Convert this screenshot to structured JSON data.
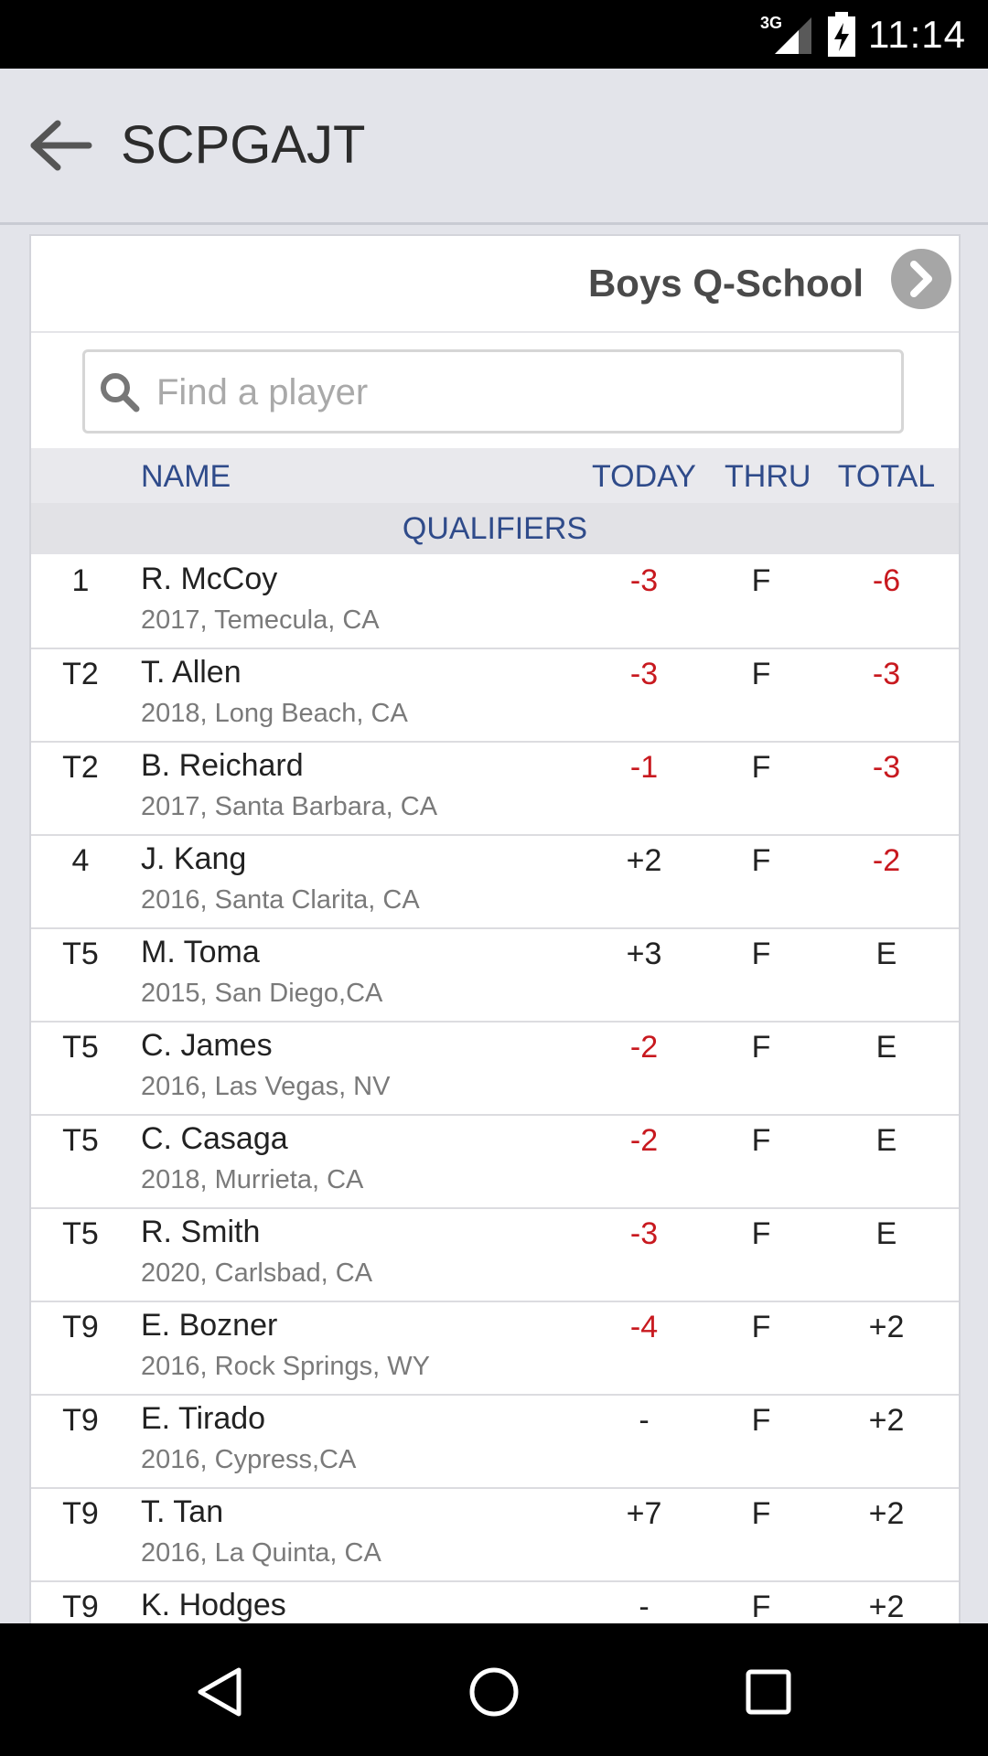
{
  "status_bar": {
    "network": "3G",
    "time": "11:14"
  },
  "app_bar": {
    "title": "SCPGAJT"
  },
  "event": {
    "name": "Boys Q-School"
  },
  "search": {
    "placeholder": "Find a player",
    "value": ""
  },
  "columns": {
    "name": "NAME",
    "today": "TODAY",
    "thru": "THRU",
    "total": "TOTAL"
  },
  "section_label": "QUALIFIERS",
  "players": [
    {
      "pos": "1",
      "name": "R. McCoy",
      "info": "2017, Temecula, CA",
      "today": "-3",
      "thru": "F",
      "total": "-6"
    },
    {
      "pos": "T2",
      "name": "T. Allen",
      "info": "2018, Long Beach, CA",
      "today": "-3",
      "thru": "F",
      "total": "-3"
    },
    {
      "pos": "T2",
      "name": "B. Reichard",
      "info": "2017, Santa Barbara, CA",
      "today": "-1",
      "thru": "F",
      "total": "-3"
    },
    {
      "pos": "4",
      "name": "J. Kang",
      "info": "2016, Santa Clarita, CA",
      "today": "+2",
      "thru": "F",
      "total": "-2"
    },
    {
      "pos": "T5",
      "name": "M. Toma",
      "info": "2015, San Diego,CA",
      "today": "+3",
      "thru": "F",
      "total": "E"
    },
    {
      "pos": "T5",
      "name": "C. James",
      "info": "2016, Las Vegas, NV",
      "today": "-2",
      "thru": "F",
      "total": "E"
    },
    {
      "pos": "T5",
      "name": "C. Casaga",
      "info": "2018, Murrieta, CA",
      "today": "-2",
      "thru": "F",
      "total": "E"
    },
    {
      "pos": "T5",
      "name": "R. Smith",
      "info": "2020, Carlsbad, CA",
      "today": "-3",
      "thru": "F",
      "total": "E"
    },
    {
      "pos": "T9",
      "name": "E. Bozner",
      "info": "2016, Rock Springs, WY",
      "today": "-4",
      "thru": "F",
      "total": "+2"
    },
    {
      "pos": "T9",
      "name": "E. Tirado",
      "info": "2016, Cypress,CA",
      "today": "-",
      "thru": "F",
      "total": "+2"
    },
    {
      "pos": "T9",
      "name": "T. Tan",
      "info": "2016, La Quinta, CA",
      "today": "+7",
      "thru": "F",
      "total": "+2"
    },
    {
      "pos": "T9",
      "name": "K. Hodges",
      "info": "",
      "today": "-",
      "thru": "F",
      "total": "+2"
    }
  ],
  "colors": {
    "under_par": "#c8191f",
    "header_text": "#2f4b8a",
    "app_bg": "#e3e4ea"
  },
  "icons": {
    "back": "arrow-left-icon",
    "next": "chevron-right-icon",
    "search": "search-icon"
  }
}
